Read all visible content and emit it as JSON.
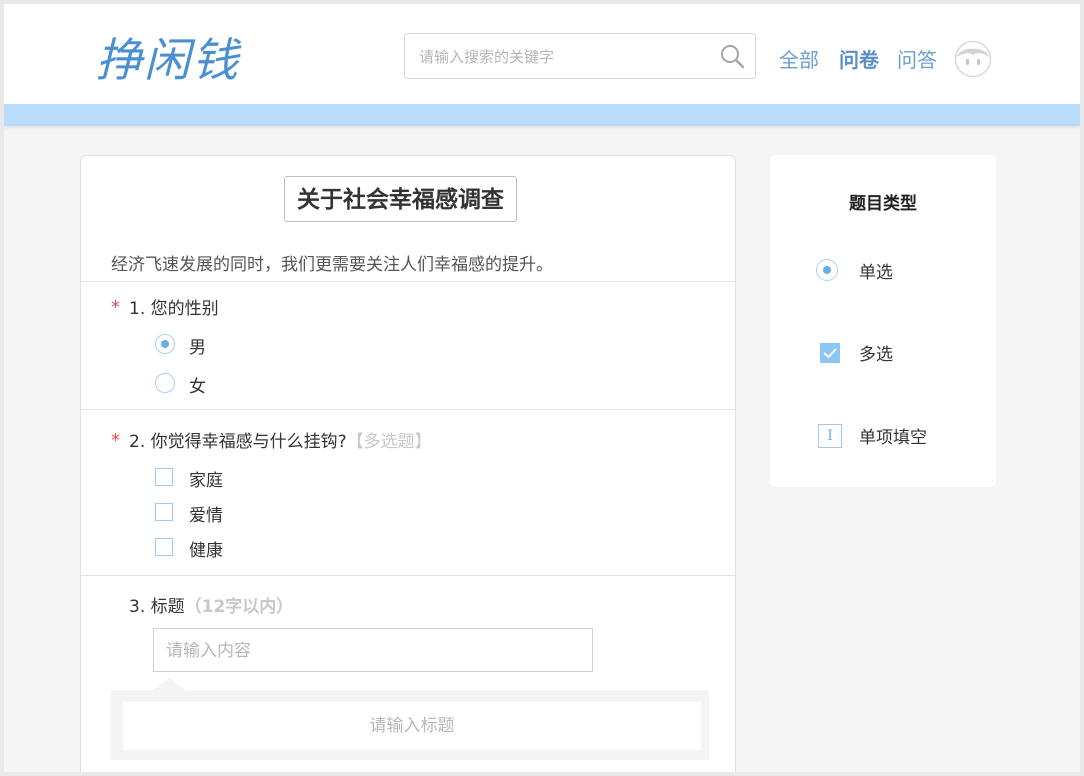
{
  "header": {
    "logo_text": "挣闲钱",
    "search": {
      "placeholder": "请输入搜索的关键字",
      "value": ""
    },
    "nav": [
      {
        "label": "全部",
        "active": false
      },
      {
        "label": "问卷",
        "active": true
      },
      {
        "label": "问答",
        "active": false
      }
    ]
  },
  "survey": {
    "title": "关于社会幸福感调查",
    "description": "经济飞速发展的同时，我们更需要关注人们幸福感的提升。",
    "questions": [
      {
        "required_mark": "*",
        "number": "1.",
        "text": "您的性别",
        "hint": "",
        "options": [
          {
            "label": "男",
            "checked": true
          },
          {
            "label": "女",
            "checked": false
          }
        ]
      },
      {
        "required_mark": "*",
        "number": "2.",
        "text": "你觉得幸福感与什么挂钩?",
        "hint": "【多选题】",
        "options": [
          {
            "label": "家庭",
            "checked": false
          },
          {
            "label": "爱情",
            "checked": false
          },
          {
            "label": "健康",
            "checked": false
          }
        ]
      },
      {
        "required_mark": "",
        "number": "3.",
        "text": "标题",
        "hint": "（12字以内）",
        "input_placeholder": "请输入内容",
        "editor_placeholder": "请输入标题"
      }
    ]
  },
  "sidebar": {
    "title": "题目类型",
    "types": [
      {
        "label": "单选",
        "icon": "radio-icon"
      },
      {
        "label": "多选",
        "icon": "checkbox-icon"
      },
      {
        "label": "单项填空",
        "icon": "text-input-icon"
      }
    ]
  },
  "colors": {
    "accent": "#6aaee8",
    "header_band": "#b9dcfb",
    "logo": "#4a8fd3",
    "required": "#e94e4e"
  }
}
